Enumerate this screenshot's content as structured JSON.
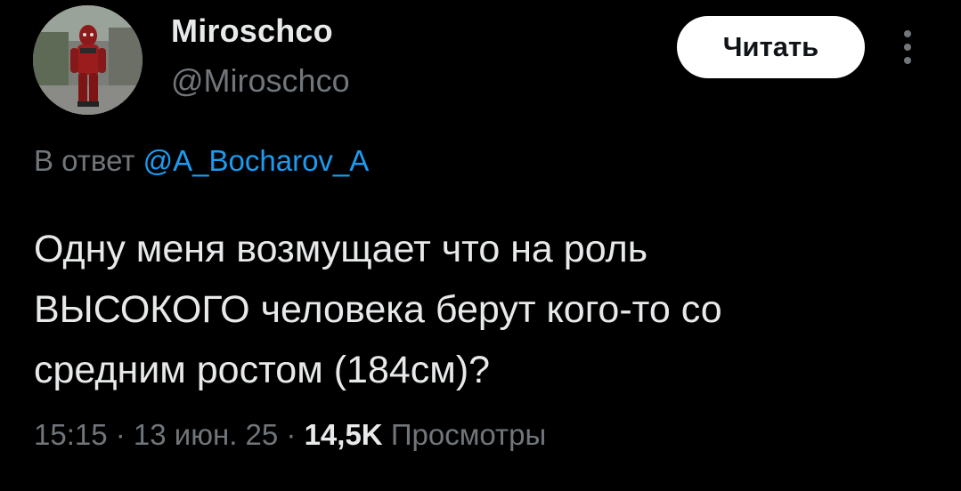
{
  "author": {
    "display_name": "Miroschco",
    "handle": "@Miroschco",
    "avatar_icon": "deadpool-avatar"
  },
  "actions": {
    "follow_label": "Читать",
    "more_icon": "more-vertical-icon"
  },
  "reply": {
    "prefix": "В ответ",
    "mention": "@A_Bocharov_A"
  },
  "tweet": {
    "lines": [
      "Одну меня возмущает что на роль",
      "ВЫСОКОГО человека берут кого-то со",
      "средним ростом (184см)?"
    ]
  },
  "meta": {
    "time": "15:15",
    "separator": " · ",
    "date": "13 июн. 25",
    "views_count": "14,5K",
    "views_label": "Просмотры"
  },
  "colors": {
    "background": "#000000",
    "text_primary": "#e7e9ea",
    "text_secondary": "#71767b",
    "accent": "#1d9bf0",
    "button_bg": "#ffffff"
  }
}
